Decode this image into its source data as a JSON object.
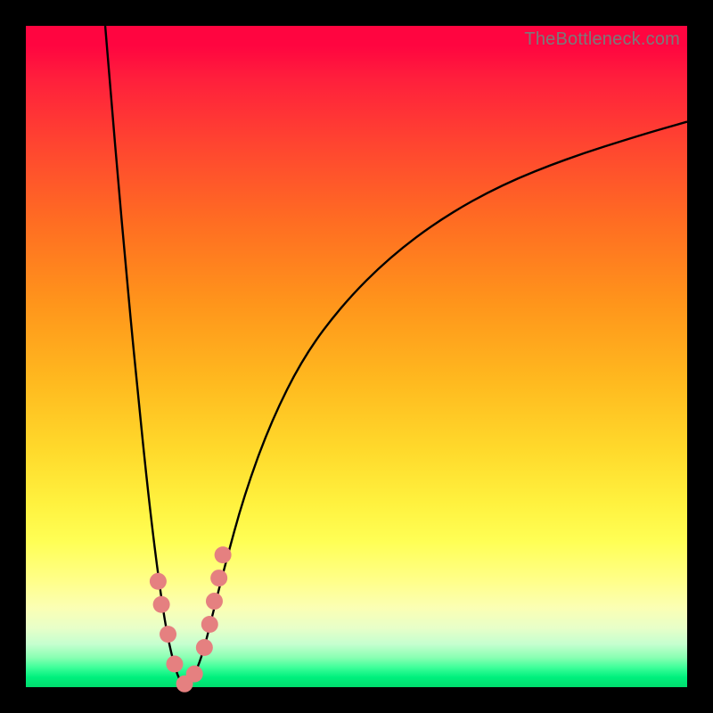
{
  "watermark": "TheBottleneck.com",
  "colors": {
    "frame_bg": "#000000",
    "curve": "#000000",
    "dots": "#e58080",
    "gradient_top": "#ff0540",
    "gradient_mid1": "#ff951b",
    "gradient_mid2": "#ffff55",
    "gradient_bottom": "#00dd6e"
  },
  "chart_data": {
    "type": "line",
    "title": "",
    "xlabel": "",
    "ylabel": "",
    "xlim": [
      0,
      100
    ],
    "ylim": [
      0,
      100
    ],
    "grid": false,
    "series": [
      {
        "name": "bottleneck-curve-left",
        "x": [
          12,
          13,
          14,
          15,
          16,
          17,
          18,
          19,
          20,
          21,
          22,
          23,
          24
        ],
        "values": [
          100,
          88,
          76,
          65,
          54,
          44,
          34,
          25,
          17,
          10,
          5,
          1.5,
          0
        ]
      },
      {
        "name": "bottleneck-curve-right",
        "x": [
          24,
          25,
          26,
          27,
          28,
          30,
          33,
          37,
          42,
          48,
          55,
          63,
          72,
          82,
          93,
          100
        ],
        "values": [
          0,
          1,
          3,
          6,
          10,
          18,
          29,
          40,
          50,
          58,
          65,
          71,
          76,
          80,
          83.5,
          85.5
        ]
      }
    ],
    "scatter": {
      "name": "highlighted-points",
      "x": [
        20.0,
        20.5,
        21.5,
        22.5,
        24.0,
        25.5,
        27.0,
        27.8,
        28.5,
        29.2,
        29.8
      ],
      "values": [
        16.0,
        12.5,
        8.0,
        3.5,
        0.5,
        2.0,
        6.0,
        9.5,
        13.0,
        16.5,
        20.0
      ]
    }
  }
}
